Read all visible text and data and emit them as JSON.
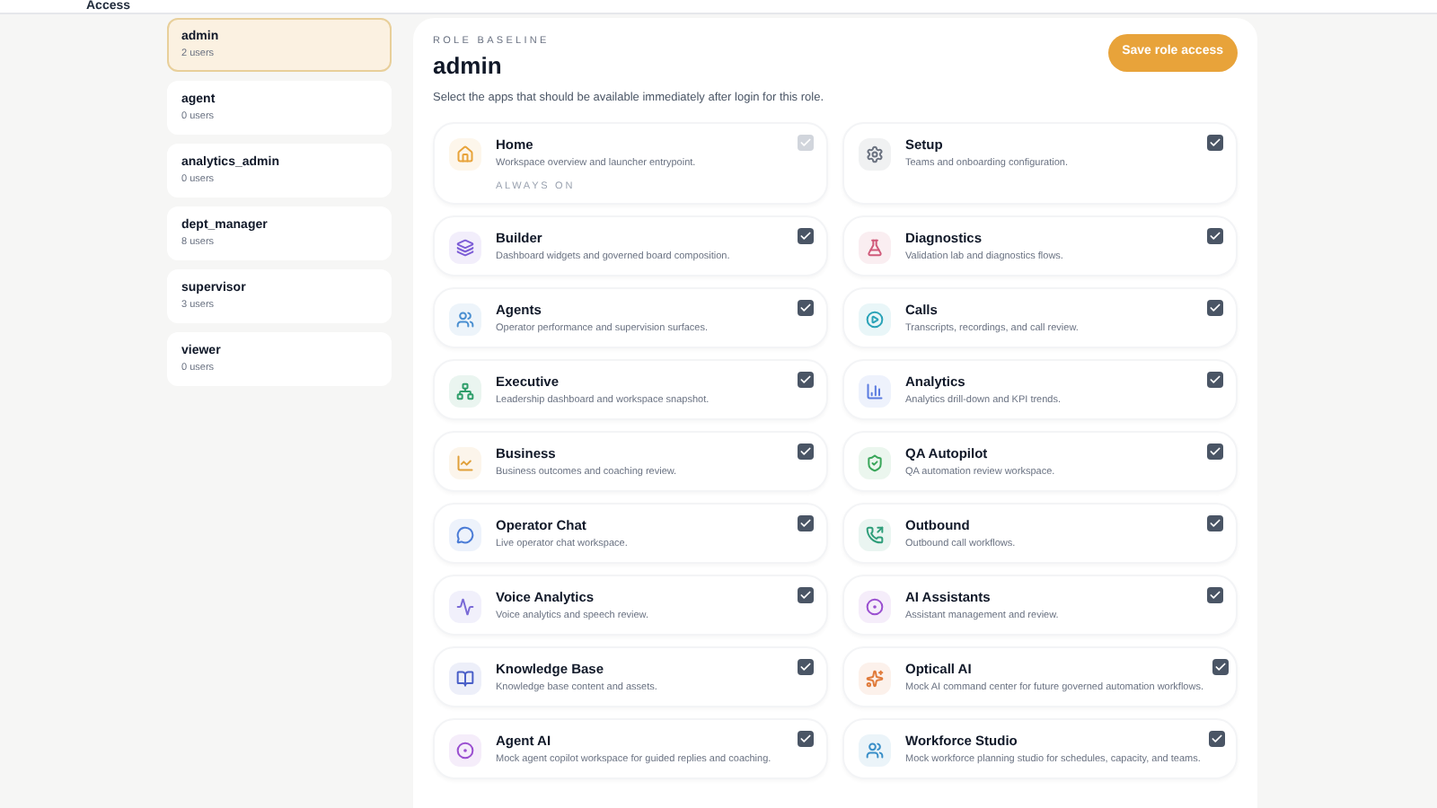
{
  "header": {
    "title": "Access"
  },
  "roles": [
    {
      "name": "admin",
      "users": "2 users",
      "selected": true
    },
    {
      "name": "agent",
      "users": "0 users",
      "selected": false
    },
    {
      "name": "analytics_admin",
      "users": "0 users",
      "selected": false
    },
    {
      "name": "dept_manager",
      "users": "8 users",
      "selected": false
    },
    {
      "name": "supervisor",
      "users": "3 users",
      "selected": false
    },
    {
      "name": "viewer",
      "users": "0 users",
      "selected": false
    }
  ],
  "panel": {
    "eyebrow": "ROLE BASELINE",
    "title": "admin",
    "description": "Select the apps that should be available immediately after login for this role.",
    "save_button": "Save role access"
  },
  "apps": [
    {
      "name": "Home",
      "description": "Workspace overview and launcher entrypoint.",
      "note": "ALWAYS ON",
      "checked": true,
      "disabled": true,
      "color": "#e8a33a"
    },
    {
      "name": "Setup",
      "description": "Teams and onboarding configuration.",
      "checked": true,
      "disabled": false,
      "color": "#6b7280"
    },
    {
      "name": "Builder",
      "description": "Dashboard widgets and governed board composition.",
      "checked": true,
      "disabled": false,
      "color": "#7c5cd6"
    },
    {
      "name": "Diagnostics",
      "description": "Validation lab and diagnostics flows.",
      "checked": true,
      "disabled": false,
      "color": "#d05a7a"
    },
    {
      "name": "Agents",
      "description": "Operator performance and supervision surfaces.",
      "checked": true,
      "disabled": false,
      "color": "#4a8fd1"
    },
    {
      "name": "Calls",
      "description": "Transcripts, recordings, and call review.",
      "checked": true,
      "disabled": false,
      "color": "#2aa3b8"
    },
    {
      "name": "Executive",
      "description": "Leadership dashboard and workspace snapshot.",
      "checked": true,
      "disabled": false,
      "color": "#2f9e6a"
    },
    {
      "name": "Analytics",
      "description": "Analytics drill-down and KPI trends.",
      "checked": true,
      "disabled": false,
      "color": "#5a7be0"
    },
    {
      "name": "Business",
      "description": "Business outcomes and coaching review.",
      "checked": true,
      "disabled": false,
      "color": "#e0a03a"
    },
    {
      "name": "QA Autopilot",
      "description": "QA automation review workspace.",
      "checked": true,
      "disabled": false,
      "color": "#3aa65a"
    },
    {
      "name": "Operator Chat",
      "description": "Live operator chat workspace.",
      "checked": true,
      "disabled": false,
      "color": "#4a7bd6"
    },
    {
      "name": "Outbound",
      "description": "Outbound call workflows.",
      "checked": true,
      "disabled": false,
      "color": "#2f9e7a"
    },
    {
      "name": "Voice Analytics",
      "description": "Voice analytics and speech review.",
      "checked": true,
      "disabled": false,
      "color": "#7a6ad6"
    },
    {
      "name": "AI Assistants",
      "description": "Assistant management and review.",
      "checked": true,
      "disabled": false,
      "color": "#9a4fd0"
    },
    {
      "name": "Knowledge Base",
      "description": "Knowledge base content and assets.",
      "checked": true,
      "disabled": false,
      "color": "#4a5fc8"
    },
    {
      "name": "Opticall AI",
      "description": "Mock AI command center for future governed automation workflows.",
      "checked": true,
      "disabled": false,
      "color": "#e07a3a"
    },
    {
      "name": "Agent AI",
      "description": "Mock agent copilot workspace for guided replies and coaching.",
      "checked": true,
      "disabled": false,
      "color": "#9a4fd0"
    },
    {
      "name": "Workforce Studio",
      "description": "Mock workforce planning studio for schedules, capacity, and teams.",
      "checked": true,
      "disabled": false,
      "color": "#3a8fc8"
    }
  ]
}
